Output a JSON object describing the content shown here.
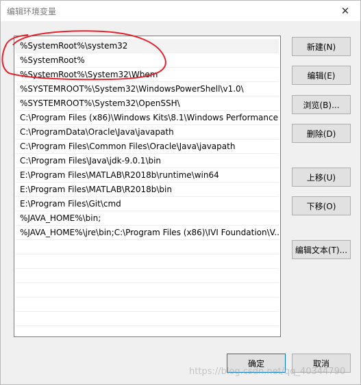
{
  "window": {
    "title": "编辑环境变量",
    "close_icon": "close-icon"
  },
  "path_list": {
    "items": [
      "%SystemRoot%\\system32",
      "%SystemRoot%",
      "%SystemRoot%\\System32\\Wbem",
      "%SYSTEMROOT%\\System32\\WindowsPowerShell\\v1.0\\",
      "%SYSTEMROOT%\\System32\\OpenSSH\\",
      "C:\\Program Files (x86)\\Windows Kits\\8.1\\Windows Performance...",
      "C:\\ProgramData\\Oracle\\Java\\javapath",
      "C:\\Program Files\\Common Files\\Oracle\\Java\\javapath",
      "C:\\Program Files\\Java\\jdk-9.0.1\\bin",
      "E:\\Program Files\\MATLAB\\R2018b\\runtime\\win64",
      "E:\\Program Files\\MATLAB\\R2018b\\bin",
      "E:\\Program Files\\Git\\cmd",
      "%JAVA_HOME%\\bin;",
      "%JAVA_HOME%\\jre\\bin;C:\\Program Files (x86)\\IVI Foundation\\V..."
    ],
    "selected_index": 0,
    "annotation_color": "#e8202a"
  },
  "buttons": {
    "new": "新建(N)",
    "edit": "编辑(E)",
    "browse": "浏览(B)...",
    "delete": "删除(D)",
    "move_up": "上移(U)",
    "move_down": "下移(O)",
    "edit_text": "编辑文本(T)...",
    "ok": "确定",
    "cancel": "取消"
  },
  "watermark": "https://blog.csdn.net/qq_40344790"
}
